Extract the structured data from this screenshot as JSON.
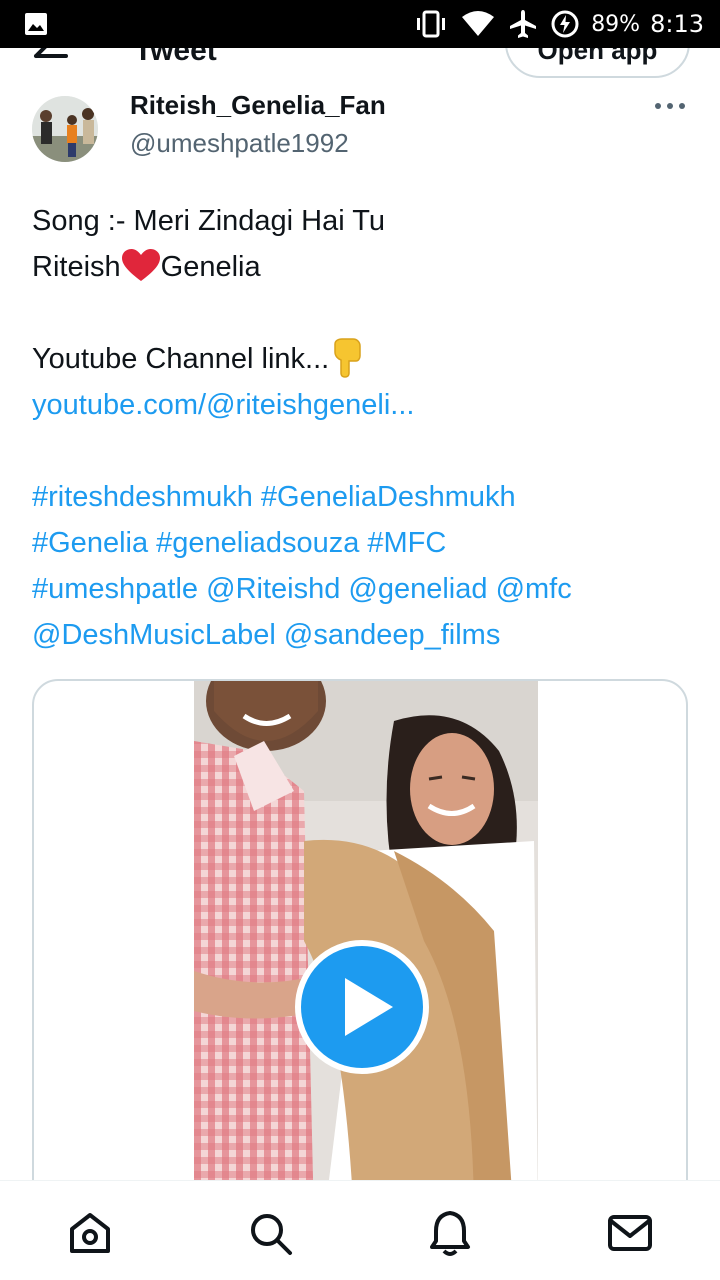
{
  "status_bar": {
    "battery": "89%",
    "time": "8:13"
  },
  "header": {
    "title": "Tweet",
    "open_app_label": "Open app"
  },
  "tweet": {
    "author_name": "Riteish_Genelia_Fan",
    "author_handle": "@umeshpatle1992",
    "line1": "Song :- Meri Zindagi Hai Tu",
    "line2_before": "Riteish",
    "line2_after": "Genelia",
    "line3": "Youtube Channel link...",
    "link": "youtube.com/@riteishgeneli...",
    "hashtags": {
      "h1": "#riteshdeshmukh",
      "h2": "#GeneliaDeshmukh",
      "h3": "#Genelia",
      "h4": "#geneliadsouza",
      "h5": "#MFC",
      "h6": "#umeshpatle",
      "m1": "@Riteishd",
      "m2": "@geneliad",
      "m3": "@mfc",
      "m4": "@DeshMusicLabel",
      "m5": "@sandeep_films"
    }
  },
  "colors": {
    "accent": "#1d9bf0",
    "text": "#0f1419",
    "secondary": "#536471",
    "border": "#cfd9de"
  },
  "nav": {
    "items": [
      "home-icon",
      "search-icon",
      "notifications-icon",
      "messages-icon"
    ]
  }
}
